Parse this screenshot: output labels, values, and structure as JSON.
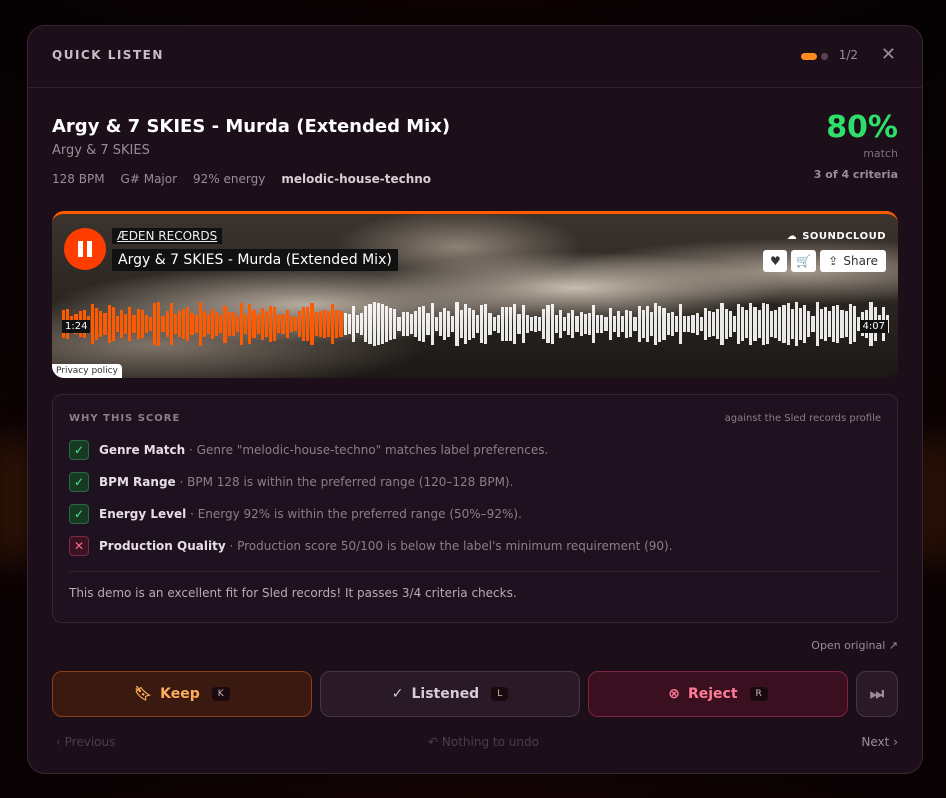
{
  "header": {
    "title": "QUICK LISTEN",
    "pager": "1/2",
    "close_icon": "close-icon"
  },
  "track": {
    "title": "Argy & 7 SKIES - Murda (Extended Mix)",
    "artist": "Argy & 7 SKIES",
    "bpm": "128 BPM",
    "key": "G# Major",
    "energy": "92% energy",
    "genre": "melodic-house-techno"
  },
  "score": {
    "percent": "80%",
    "label": "match",
    "criteria": "3 of 4 criteria",
    "color": "#2ee06a"
  },
  "player": {
    "label": "ÆDEN RECORDS",
    "title": "Argy & 7 SKIES - Murda (Extended Mix)",
    "brand": "SOUNDCLOUD",
    "share": "Share",
    "time_elapsed": "1:24",
    "time_total": "4:07",
    "progress": 0.34,
    "privacy": "Privacy policy",
    "accent": "#ff5a00"
  },
  "why": {
    "title": "WHY THIS SCORE",
    "subtitle": "against the Sled records profile",
    "criteria": [
      {
        "name": "Genre Match",
        "detail": "· Genre \"melodic-house-techno\" matches label preferences.",
        "pass": true,
        "icon": "check-icon"
      },
      {
        "name": "BPM Range",
        "detail": "· BPM 128 is within the preferred range (120–128 BPM).",
        "pass": true,
        "icon": "check-icon"
      },
      {
        "name": "Energy Level",
        "detail": "· Energy 92% is within the preferred range (50%–92%).",
        "pass": true,
        "icon": "check-icon"
      },
      {
        "name": "Production Quality",
        "detail": "· Production score 50/100 is below the label's minimum requirement (90).",
        "pass": false,
        "icon": "x-icon"
      }
    ],
    "summary": "This demo is an excellent fit for Sled records! It passes 3/4 criteria checks."
  },
  "actions": {
    "open_original": "Open original",
    "keep": {
      "label": "Keep",
      "key": "K"
    },
    "listened": {
      "label": "Listened",
      "key": "L"
    },
    "reject": {
      "label": "Reject",
      "key": "R"
    }
  },
  "footer": {
    "previous": "Previous",
    "undo": "Nothing to undo",
    "next": "Next"
  }
}
